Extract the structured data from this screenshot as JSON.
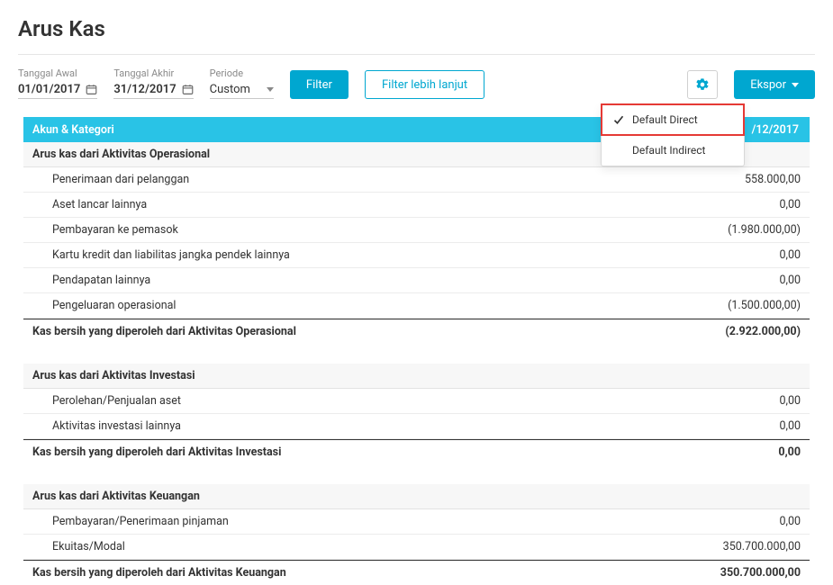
{
  "page_title": "Arus Kas",
  "filters": {
    "start_label": "Tanggal Awal",
    "start_value": "01/01/2017",
    "end_label": "Tanggal Akhir",
    "end_value": "31/12/2017",
    "period_label": "Periode",
    "period_value": "Custom",
    "filter_btn": "Filter",
    "advanced_btn": "Filter lebih lanjut",
    "export_btn": "Ekspor"
  },
  "gear_menu": {
    "items": [
      {
        "label": "Default Direct",
        "checked": true,
        "highlight": true
      },
      {
        "label": "Default Indirect",
        "checked": false,
        "highlight": false
      }
    ]
  },
  "table": {
    "header_left": "Akun & Kategori",
    "header_right": "/12/2017",
    "sections": [
      {
        "title": "Arus kas dari Aktivitas Operasional",
        "rows": [
          {
            "label": "Penerimaan dari pelanggan",
            "value": "558.000,00"
          },
          {
            "label": "Aset lancar lainnya",
            "value": "0,00"
          },
          {
            "label": "Pembayaran ke pemasok",
            "value": "(1.980.000,00)"
          },
          {
            "label": "Kartu kredit dan liabilitas jangka pendek lainnya",
            "value": "0,00"
          },
          {
            "label": "Pendapatan lainnya",
            "value": "0,00"
          },
          {
            "label": "Pengeluaran operasional",
            "value": "(1.500.000,00)"
          }
        ],
        "total": {
          "label": "Kas bersih yang diperoleh dari Aktivitas Operasional",
          "value": "(2.922.000,00)"
        }
      },
      {
        "title": "Arus kas dari Aktivitas Investasi",
        "rows": [
          {
            "label": "Perolehan/Penjualan aset",
            "value": "0,00"
          },
          {
            "label": "Aktivitas investasi lainnya",
            "value": "0,00"
          }
        ],
        "total": {
          "label": "Kas bersih yang diperoleh dari Aktivitas Investasi",
          "value": "0,00"
        }
      },
      {
        "title": "Arus kas dari Aktivitas Keuangan",
        "rows": [
          {
            "label": "Pembayaran/Penerimaan pinjaman",
            "value": "0,00"
          },
          {
            "label": "Ekuitas/Modal",
            "value": "350.700.000,00"
          }
        ],
        "total": {
          "label": "Kas bersih yang diperoleh dari Aktivitas Keuangan",
          "value": "350.700.000,00"
        }
      }
    ]
  }
}
